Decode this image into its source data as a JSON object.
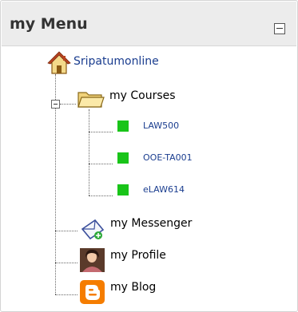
{
  "menu": {
    "title": "my Menu",
    "collapse_icon": "minus-box-icon",
    "home": {
      "label": "Sripatumonline",
      "icon": "home-icon"
    },
    "courses": {
      "label": "my Courses",
      "icon": "folder-open-icon",
      "toggle_icon": "tree-collapse-icon",
      "items": [
        {
          "label": "LAW500",
          "icon": "green-square-icon"
        },
        {
          "label": "OOE-TA001",
          "icon": "green-square-icon"
        },
        {
          "label": "eLAW614",
          "icon": "green-square-icon"
        }
      ]
    },
    "messenger": {
      "label": "my Messenger",
      "icon": "envelope-icon"
    },
    "profile": {
      "label": "my Profile",
      "icon": "profile-photo-icon"
    },
    "blog": {
      "label": "my Blog",
      "icon": "blogger-icon"
    }
  },
  "colors": {
    "header_bg": "#ececec",
    "link": "#1a3d8f",
    "course_bullet": "#19c419",
    "blog_orange": "#f57d00"
  }
}
